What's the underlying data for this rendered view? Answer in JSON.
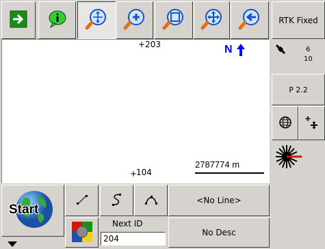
{
  "toolbar": {
    "buttons": [
      {
        "name": "next-arrow-icon"
      },
      {
        "name": "info-balloon-icon"
      },
      {
        "name": "zoom-extents-icon"
      },
      {
        "name": "zoom-in-icon"
      },
      {
        "name": "zoom-window-icon"
      },
      {
        "name": "pan-icon"
      },
      {
        "name": "zoom-previous-icon"
      }
    ]
  },
  "status": {
    "fix_label": "RTK Fixed",
    "sats_used": "6",
    "sats_total": "10",
    "pdop": "P 2.2"
  },
  "map": {
    "north_label": "N",
    "point_top": "+203",
    "point_bottom_prefix": "+",
    "point_bottom": "104",
    "scale_text": "2787774 m"
  },
  "bottom": {
    "start_label": "Start",
    "line_select": "<No Line>",
    "next_id_label": "Next ID",
    "next_id_value": "204",
    "desc_button": "No Desc"
  },
  "colors": {
    "map_blue": "#0000ff",
    "arrow_green": "#1a8c1a"
  }
}
